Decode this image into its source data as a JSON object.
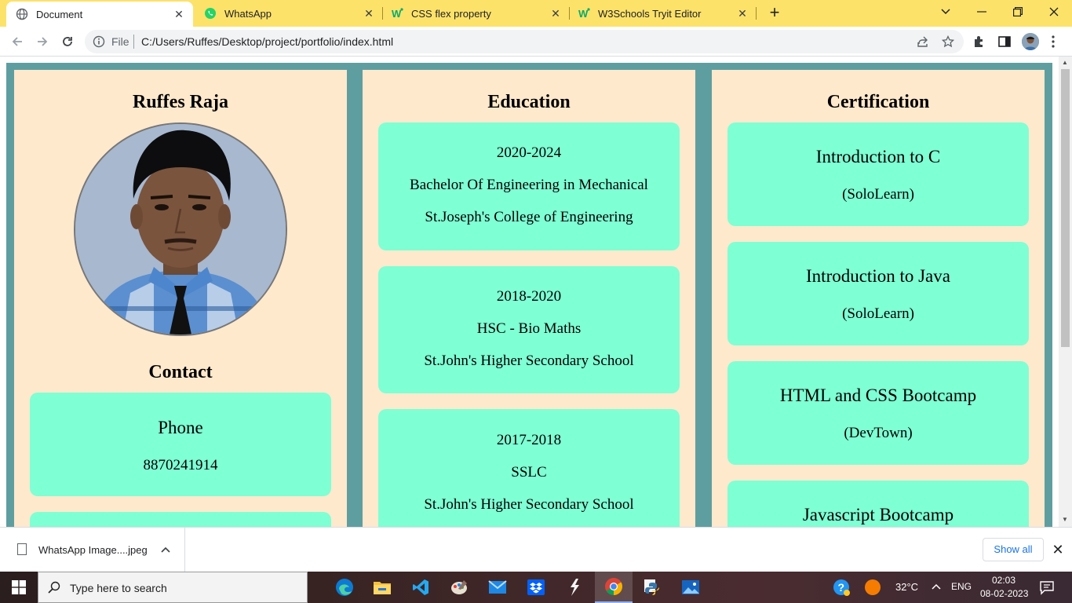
{
  "browser": {
    "tabs": [
      {
        "title": "Document",
        "active": true
      },
      {
        "title": "WhatsApp",
        "active": false
      },
      {
        "title": "CSS flex property",
        "active": false
      },
      {
        "title": "W3Schools Tryit Editor",
        "active": false
      }
    ],
    "omnibox": {
      "scheme_label": "File",
      "url": "C:/Users/Ruffes/Desktop/project/portfolio/index.html"
    },
    "colors": {
      "tabstrip": "#fde26a",
      "accent": "#1a73e8"
    }
  },
  "page": {
    "colors": {
      "stage": "#5f9ea0",
      "column": "#ffe9cc",
      "card": "#7fffd4"
    },
    "profile": {
      "name": "Ruffes Raja",
      "contact_heading": "Contact",
      "contact_cards": [
        {
          "title": "Phone",
          "value": "8870241914"
        }
      ]
    },
    "education": {
      "heading": "Education",
      "entries": [
        {
          "years": "2020-2024",
          "degree": "Bachelor Of Engineering in Mechanical",
          "institution": "St.Joseph's College of Engineering"
        },
        {
          "years": "2018-2020",
          "degree": "HSC - Bio Maths",
          "institution": "St.John's Higher Secondary School"
        },
        {
          "years": "2017-2018",
          "degree": "SSLC",
          "institution": "St.John's Higher Secondary School"
        }
      ]
    },
    "certification": {
      "heading": "Certification",
      "entries": [
        {
          "title": "Introduction to C",
          "provider": "(SoloLearn)"
        },
        {
          "title": "Introduction to Java",
          "provider": "(SoloLearn)"
        },
        {
          "title": "HTML and CSS Bootcamp",
          "provider": "(DevTown)"
        },
        {
          "title": "Javascript Bootcamp",
          "provider": ""
        }
      ]
    }
  },
  "downloads": {
    "file_name": "WhatsApp Image....jpeg",
    "show_all_label": "Show all"
  },
  "taskbar": {
    "search_placeholder": "Type here to search",
    "weather": "32°C",
    "language": "ENG",
    "time": "02:03",
    "date": "08-02-2023"
  }
}
